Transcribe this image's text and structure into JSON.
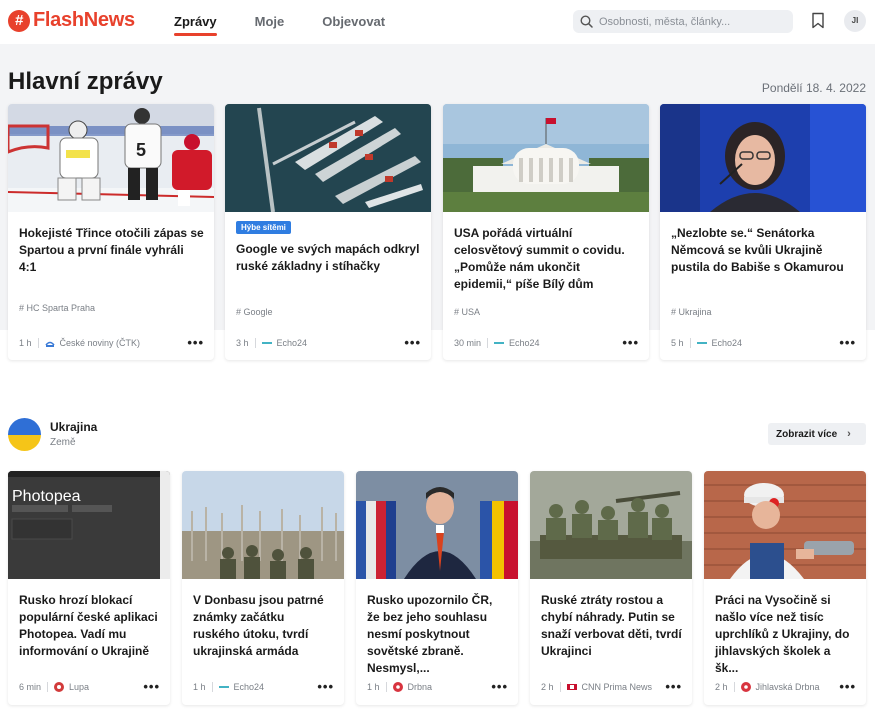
{
  "brand": {
    "logo_glyph": "#",
    "name": "FlashNews",
    "color": "#e8412c"
  },
  "nav": {
    "items": [
      "Zprávy",
      "Moje",
      "Objevovat"
    ],
    "active": "Zprávy"
  },
  "search": {
    "placeholder": "Osobnosti, města, články..."
  },
  "user": {
    "initials": "JI"
  },
  "main": {
    "title": "Hlavní zprávy",
    "date": "Pondělí 18. 4. 2022",
    "cards": [
      {
        "headline": "Hokejisté Třince otočili zápas se Spartou a první finále vyhráli 4:1",
        "tag": "HC Sparta Praha",
        "time": "1 h",
        "source": "České noviny (ČTK)"
      },
      {
        "badge": "Hýbe sítěmi",
        "headline": "Google ve svých mapách odkryl ruské základny i stíhačky",
        "tag": "Google",
        "time": "3 h",
        "source": "Echo24"
      },
      {
        "headline": "USA pořádá virtuální celosvětový summit o covidu. „Pomůže nám ukončit epidemii,“ píše Bílý dům",
        "tag": "USA",
        "time": "30 min",
        "source": "Echo24"
      },
      {
        "headline": "„Nezlobte se.“ Senátorka Němcová se kvůli Ukrajině pustila do Babiše s Okamurou",
        "tag": "Ukrajina",
        "time": "5 h",
        "source": "Echo24"
      }
    ]
  },
  "topic": {
    "name": "Ukrajina",
    "type": "Země",
    "more_label": "Zobrazit více",
    "cards": [
      {
        "image_text": "Photopea",
        "headline": "Rusko hrozí blokací populární české aplikaci Photopea. Vadí mu informování o Ukrajině",
        "time": "6 min",
        "source": "Lupa"
      },
      {
        "headline": "V Donbasu jsou patrné známky začátku ruského útoku, tvrdí ukrajinská armáda",
        "time": "1 h",
        "source": "Echo24"
      },
      {
        "headline": "Rusko upozornilo ČR, že bez jeho souhlasu nesmí poskytnout sovětské zbraně. Nesmysl,...",
        "time": "1 h",
        "source": "Drbna"
      },
      {
        "headline": "Ruské ztráty rostou a chybí náhrady. Putin se snaží verbovat děti, tvrdí Ukrajinci",
        "time": "2 h",
        "source": "CNN Prima News"
      },
      {
        "headline": "Práci na Vysočině si našlo více než tisíc uprchlíků z Ukrajiny, do jihlavských školek a šk...",
        "time": "2 h",
        "source": "Jihlavská Drbna"
      }
    ]
  }
}
